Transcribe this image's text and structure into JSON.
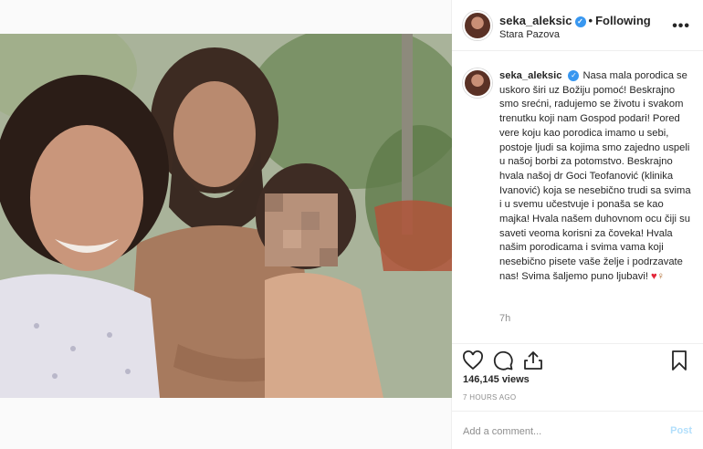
{
  "post": {
    "username": "seka_aleksic",
    "follow_label": "Following",
    "separator": "•",
    "location": "Stara Pazova",
    "more_icon": "more-horizontal-icon",
    "verified_icon": "verified-badge-icon",
    "photo_description": "selfie-family-photo"
  },
  "caption": {
    "username": "seka_aleksic",
    "text": "Nasa mala porodica se uskoro širi uz Božiju pomoć! Beskrajno smo srećni, radujemo se životu i svakom trenutku koji nam Gospod podari! Pored vere koju kao porodica imamo u sebi, postoje ljudi sa kojima smo zajedno uspeli u našoj borbi za potomstvo. Beskrajno hvala našoj dr Goci Teofanović (klinika Ivanović) koja se nesebično trudi sa svima i u svemu učestvuje i ponaša se kao majka! Hvala našem duhovnom ocu čiji su saveti veoma korisni za čoveka! Hvala našim porodicama i svima vama koji nesebično pisete vaše želje i podrzavate nas! Svima šaljemo puno ljubavi!",
    "emoji_heart": "♥",
    "emoji_figure": "♀",
    "time_ago": "7h"
  },
  "actions": {
    "like_icon": "heart-outline-icon",
    "comment_icon": "comment-bubble-icon",
    "share_icon": "share-upload-icon",
    "save_icon": "bookmark-icon"
  },
  "stats": {
    "views": "146,145 views",
    "posted": "7 HOURS AGO"
  },
  "comment_box": {
    "placeholder": "Add a comment...",
    "post_label": "Post"
  },
  "colors": {
    "accent": "#3897f0",
    "post_disabled": "#b2dffc",
    "muted": "#8e8e8e",
    "border": "#efefef"
  }
}
